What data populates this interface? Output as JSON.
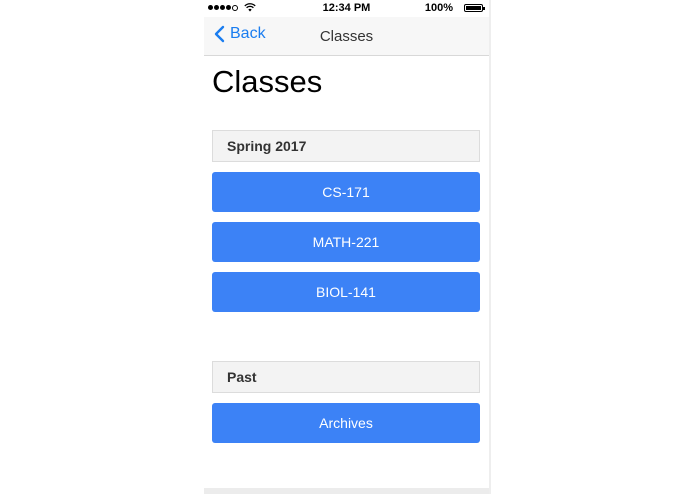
{
  "status_bar": {
    "time": "12:34 PM",
    "battery": "100%"
  },
  "nav": {
    "back_label": "Back",
    "title": "Classes"
  },
  "page": {
    "title": "Classes"
  },
  "sections": [
    {
      "header": "Spring 2017",
      "items": [
        "CS-171",
        "MATH-221",
        "BIOL-141"
      ]
    },
    {
      "header": "Past",
      "items": [
        "Archives"
      ]
    }
  ],
  "colors": {
    "accent": "#1a7df0",
    "button": "#3c82f6"
  }
}
